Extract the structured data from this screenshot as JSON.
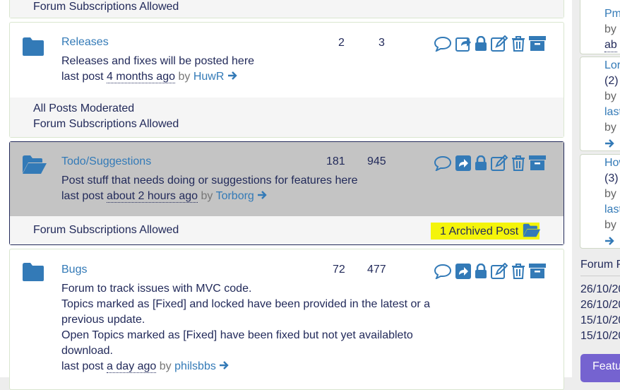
{
  "top_footer": {
    "line1": "Forum Subscriptions Allowed"
  },
  "forums": [
    {
      "title": "Releases",
      "topics": "2",
      "posts": "3",
      "description": "Releases and fixes will be posted here",
      "last_post_label": "last post",
      "last_post_time": "4 months ago",
      "by_label": "by",
      "last_poster": "HuwR",
      "footer_lines": [
        "All Posts Moderated",
        "Forum Subscriptions Allowed"
      ]
    },
    {
      "title": "Todo/Suggestions",
      "topics": "181",
      "posts": "945",
      "description": "Post stuff that needs doing or suggestions for features here",
      "last_post_label": "last post",
      "last_post_time": "about 2 hours ago",
      "by_label": "by",
      "last_poster": "Torborg",
      "footer_lines": [
        "Forum Subscriptions Allowed"
      ],
      "archived_label": "1 Archived Post"
    },
    {
      "title": "Bugs",
      "topics": "72",
      "posts": "477",
      "description_lines": [
        "Forum to track issues with MVC code.",
        "Topics marked as [Fixed] and locked have been provided in the latest or a",
        "previous update.",
        "Open Topics marked as [Fixed] have been fixed but not yet availableto",
        "download."
      ],
      "last_post_label": "last post",
      "last_post_time": "a day ago",
      "by_label": "by",
      "last_poster": "philsbbs"
    }
  ],
  "sidebar": {
    "card1": [
      "Pm",
      "by",
      "ab"
    ],
    "card2": [
      "Lor",
      "(2)",
      "by",
      "last",
      "by"
    ],
    "card3": [
      "How",
      "(3)",
      "by",
      "last",
      "by"
    ],
    "section_title": "Forum P",
    "dates": [
      "26/10/20",
      "26/10/20",
      "15/10/20",
      "15/10/20"
    ],
    "button_label": "Featu"
  },
  "colors": {
    "accent": "#337ab7",
    "text": "#222a5a",
    "highlight": "#f4f40a",
    "button": "#7563d0"
  }
}
